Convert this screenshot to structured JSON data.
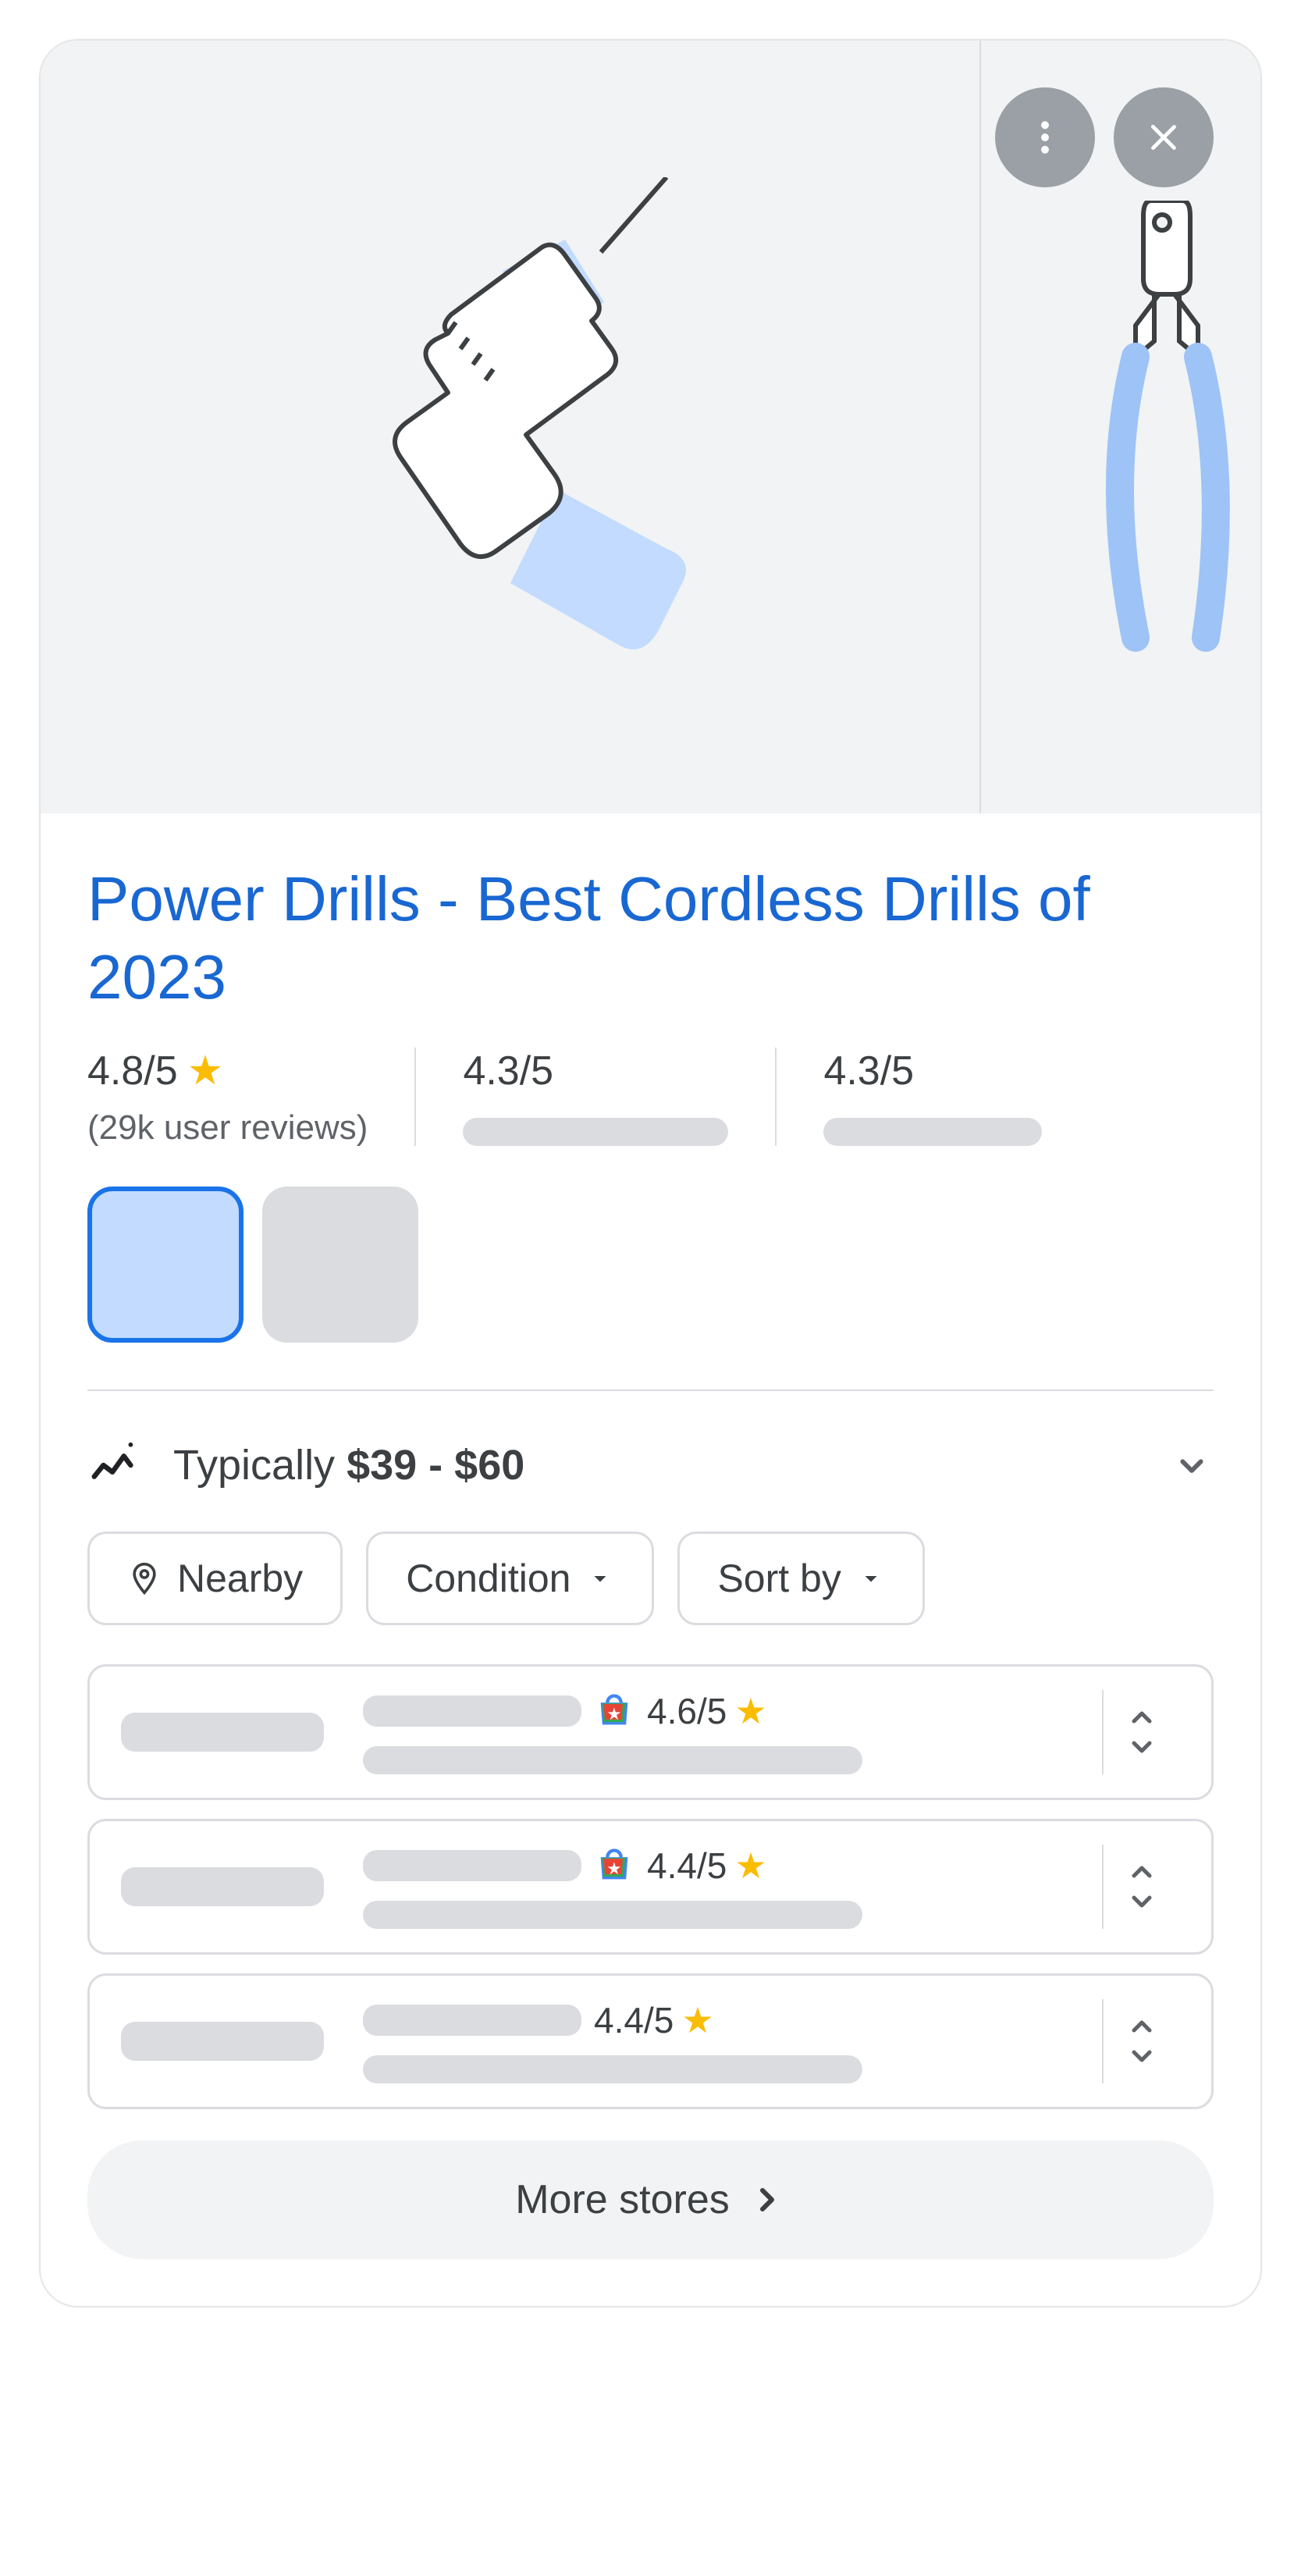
{
  "title": "Power Drills - Best Cordless Drills of 2023",
  "ratings": [
    {
      "score": "4.8/5",
      "sub": "(29k user reviews)",
      "has_star": true
    },
    {
      "score": "4.3/5",
      "sub": null,
      "has_star": false
    },
    {
      "score": "4.3/5",
      "sub": null,
      "has_star": false
    }
  ],
  "price": {
    "label": "Typically ",
    "range": "$39 - $60"
  },
  "filters": {
    "nearby": "Nearby",
    "condition": "Condition",
    "sortby": "Sort by"
  },
  "stores": [
    {
      "rating": "4.6/5",
      "trusted": true
    },
    {
      "rating": "4.4/5",
      "trusted": true
    },
    {
      "rating": "4.4/5",
      "trusted": false
    }
  ],
  "more_label": "More stores"
}
